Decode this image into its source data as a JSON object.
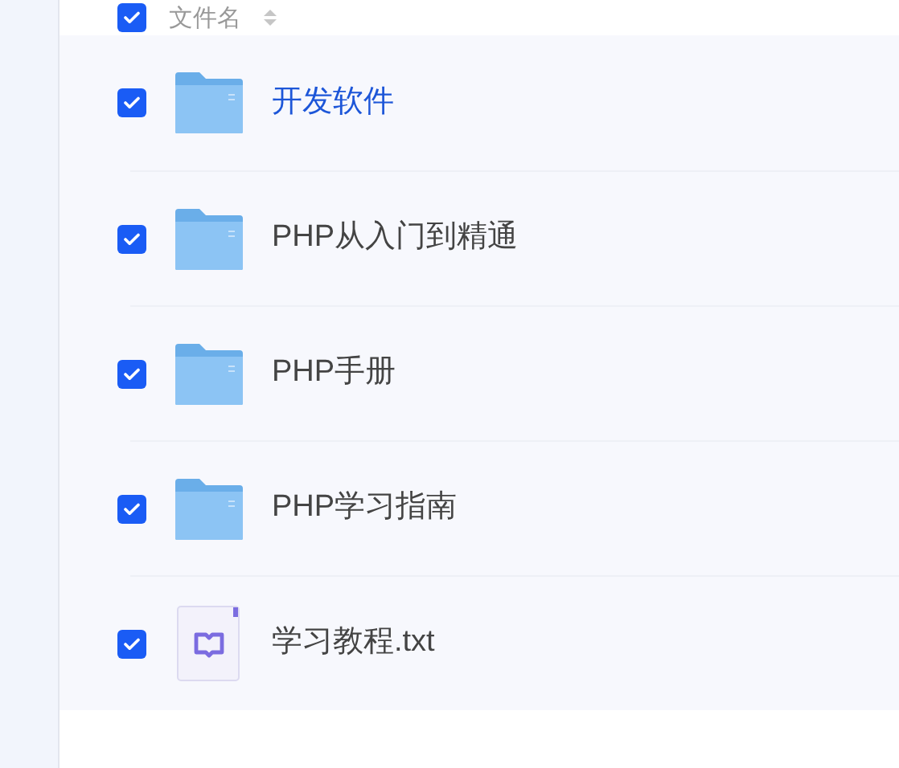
{
  "header": {
    "checked": true,
    "label": "文件名"
  },
  "files": [
    {
      "kind": "folder",
      "name": "开发软件",
      "checked": true,
      "highlighted": true
    },
    {
      "kind": "folder",
      "name": "PHP从入门到精通",
      "checked": true,
      "highlighted": false
    },
    {
      "kind": "folder",
      "name": "PHP手册",
      "checked": true,
      "highlighted": false
    },
    {
      "kind": "folder",
      "name": "PHP学习指南",
      "checked": true,
      "highlighted": false
    },
    {
      "kind": "text",
      "name": "学习教程.txt",
      "checked": true,
      "highlighted": false
    }
  ]
}
